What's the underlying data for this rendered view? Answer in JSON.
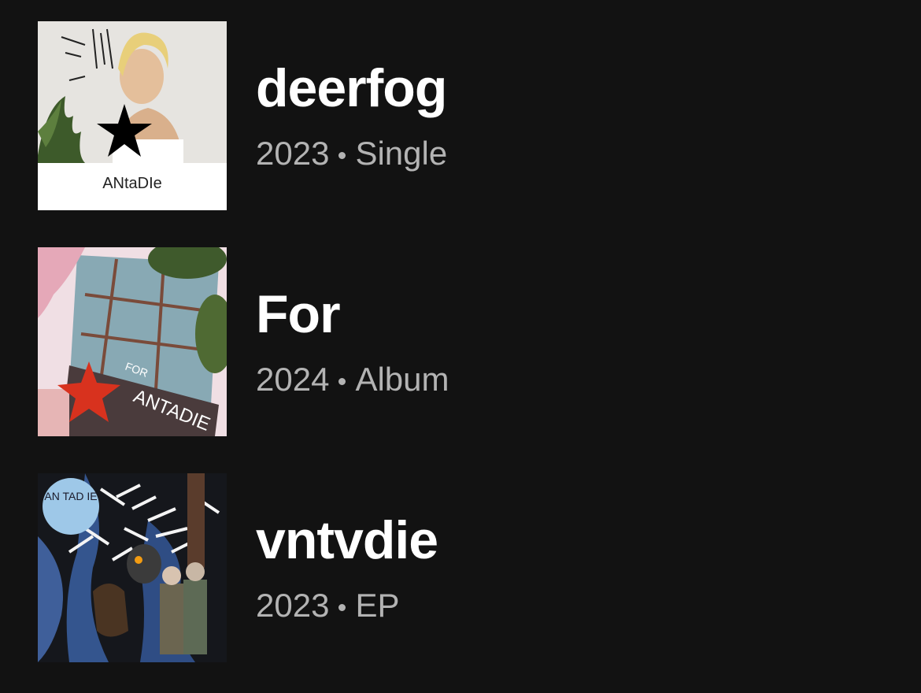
{
  "releases": [
    {
      "title": "deerfog",
      "year": "2023",
      "type": "Single",
      "cover_text": "ANtaDIe"
    },
    {
      "title": "For",
      "year": "2024",
      "type": "Album",
      "cover_text": "ANTADIE",
      "cover_text_small": "FOR"
    },
    {
      "title": "vntvdie",
      "year": "2023",
      "type": "EP",
      "cover_text": "AN TAD IE"
    }
  ],
  "separator": "•",
  "colors": {
    "background": "#121212",
    "title": "#ffffff",
    "subtitle": "#b3b3b3"
  }
}
